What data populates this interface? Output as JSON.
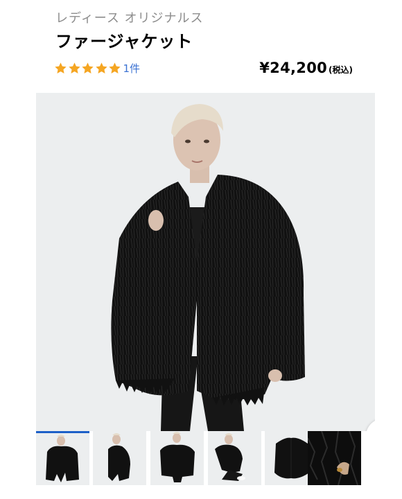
{
  "product": {
    "category": "レディース オリジナルス",
    "name": "ファージャケット",
    "rating_stars": 5,
    "review_count": "1件",
    "price": "¥24,200",
    "tax_note": "(税込)"
  },
  "colors": {
    "star": "#f5a623",
    "link": "#3c73d3",
    "active_thumb": "#1d5fc8",
    "gallery_bg": "#eceeef"
  },
  "gallery": {
    "current_index": 1,
    "thumbnail_count": 6
  },
  "icons": {
    "next": "chevron-right-icon",
    "zoom": "zoom-in-icon",
    "star": "star-icon"
  }
}
